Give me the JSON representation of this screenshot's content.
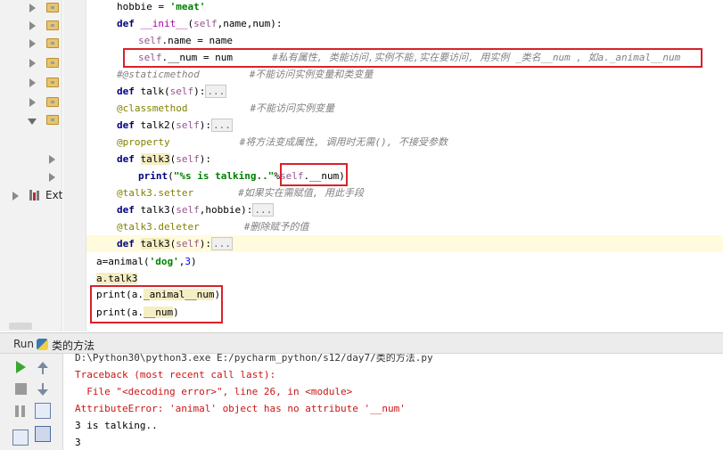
{
  "project_tree": {
    "items": [
      {
        "expanded": false
      },
      {
        "expanded": false
      },
      {
        "expanded": false
      },
      {
        "expanded": false
      },
      {
        "expanded": false
      },
      {
        "expanded": false
      },
      {
        "expanded": true
      }
    ],
    "external_label": "Ext"
  },
  "code": {
    "line1": {
      "a": "hobbie = ",
      "b": "'meat'"
    },
    "line2": {
      "kw": "def ",
      "fn": "__init__",
      "p1": "(",
      "self": "self",
      "rest": ",name,num):"
    },
    "line3": {
      "self": "self",
      "rest": ".name = name"
    },
    "line4": {
      "self": "self",
      "rest": ".__num = num",
      "comment": "#私有属性, 类能访问,实例不能,实在要访问, 用实例 _类名__num , 如a._animal__num"
    },
    "line5": {
      "deco": "#@staticmethod",
      "comment": "#不能访问实例变量和类变量"
    },
    "line6": {
      "kw": "def ",
      "fn": "talk",
      "p": "(",
      "self": "self",
      "close": "):",
      "dots": "..."
    },
    "line7": {
      "deco": "@classmethod",
      "comment": "#不能访问实例变量"
    },
    "line8": {
      "kw": "def ",
      "fn": "talk2",
      "p": "(",
      "self": "self",
      "close": "):",
      "dots": "..."
    },
    "line9": {
      "deco": "@property",
      "comment": "#将方法变成属性, 调用时无需(), 不接受参数"
    },
    "line10": {
      "kw": "def ",
      "fn": "talk3",
      "p": "(",
      "self": "self",
      "close": "):"
    },
    "line11": {
      "kw": "print",
      "p": "(",
      "str": "\"%s is talking..\"",
      "pct": "%",
      "self": "self",
      "rest": ".__num)"
    },
    "line12": {
      "deco": "@talk3.setter",
      "comment": "#如果实在需赋值, 用此手段"
    },
    "line13": {
      "kw": "def ",
      "fn": "talk3",
      "p": "(",
      "self": "self",
      "rest": ",hobbie):",
      "dots": "..."
    },
    "line14": {
      "deco": "@talk3.deleter",
      "comment": "#删除赋予的值"
    },
    "line15": {
      "kw": "def ",
      "fn": "talk3",
      "p": "(",
      "self": "self",
      "close": "):",
      "dots": "..."
    },
    "line16": {
      "a": "a=animal(",
      "s": "'dog'",
      "b": ",",
      "n": "3",
      "c": ")"
    },
    "line17": {
      "a": "a.talk3"
    },
    "line18": {
      "kw": "print",
      "a": "(a.",
      "hl": "_animal__num",
      "b": ")"
    },
    "line19": {
      "kw": "print",
      "a": "(a.",
      "hl": "__num",
      "b": ")"
    }
  },
  "run_panel": {
    "run_label": "Run",
    "config_name": "类的方法",
    "console": {
      "cmd": "D:\\Python30\\python3.exe E:/pycharm_python/s12/day7/类的方法.py",
      "traceback": "Traceback (most recent call last):",
      "file_line": "  File \"<decoding error>\", line 26, in <module>",
      "error": "AttributeError: 'animal' object has no attribute '__num'",
      "out1": "3 is talking..",
      "out2": "3"
    }
  },
  "colors": {
    "keyword": "#000080",
    "self": "#94558d",
    "string": "#008000",
    "decorator": "#808000",
    "comment": "#808080",
    "error": "#c91515",
    "highlight_box": "#d9222a"
  }
}
